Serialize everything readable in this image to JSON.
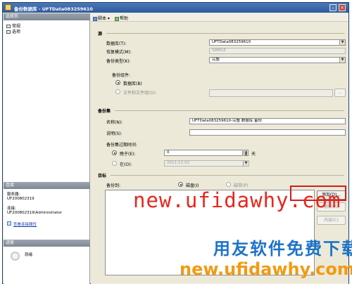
{
  "window": {
    "title": "备份数据库 - UFTData083259610"
  },
  "left_pane": {
    "select_page_header": "选择页",
    "nav_items": [
      {
        "label": "常规"
      },
      {
        "label": "选项"
      }
    ],
    "connection_header": "连接",
    "server_label": "服务器:",
    "server_value": "UF200802319",
    "connection_label": "连接:",
    "connection_value": "UF200802319\\Administrator",
    "view_connection_link": "查看连接属性",
    "progress_header": "进度",
    "progress_status": "就绪"
  },
  "toolbar": {
    "script_label": "脚本",
    "help_label": "帮助"
  },
  "source": {
    "group_label": "源",
    "database_label": "数据库(T):",
    "database_value": "UFTData083259610",
    "recovery_model_label": "恢复模式(M):",
    "recovery_model_value": "SIMPLE",
    "backup_type_label": "备份类型(K):",
    "backup_type_value": "完整",
    "component_label": "备份组件:",
    "component_database_label": "数据库(B)",
    "component_files_label": "文件和文件组(G):"
  },
  "backup_set": {
    "group_label": "备份集",
    "name_label": "名称(N):",
    "name_value": "UFTData083259610-完整 数据库 备份",
    "description_label": "说明(S):",
    "description_value": "",
    "expiry_label": "备份集过期时间:",
    "after_label": "晚于(E):",
    "after_value": "0",
    "days_unit": "天",
    "on_label": "在(O):",
    "on_value": "2011-11-02"
  },
  "destination": {
    "group_label": "目标",
    "backup_to_label": "备份到:",
    "disk_label": "磁盘(I)",
    "tape_label": "磁带(P)",
    "add_button": "添加(D)...",
    "remove_button": "删除(R)",
    "contents_button": "内容(C)"
  },
  "watermark": {
    "url_top": "new.ufidawhy.com",
    "slogan": "用友软件免费下载",
    "url_bottom": "new.ufidawhy.com"
  }
}
